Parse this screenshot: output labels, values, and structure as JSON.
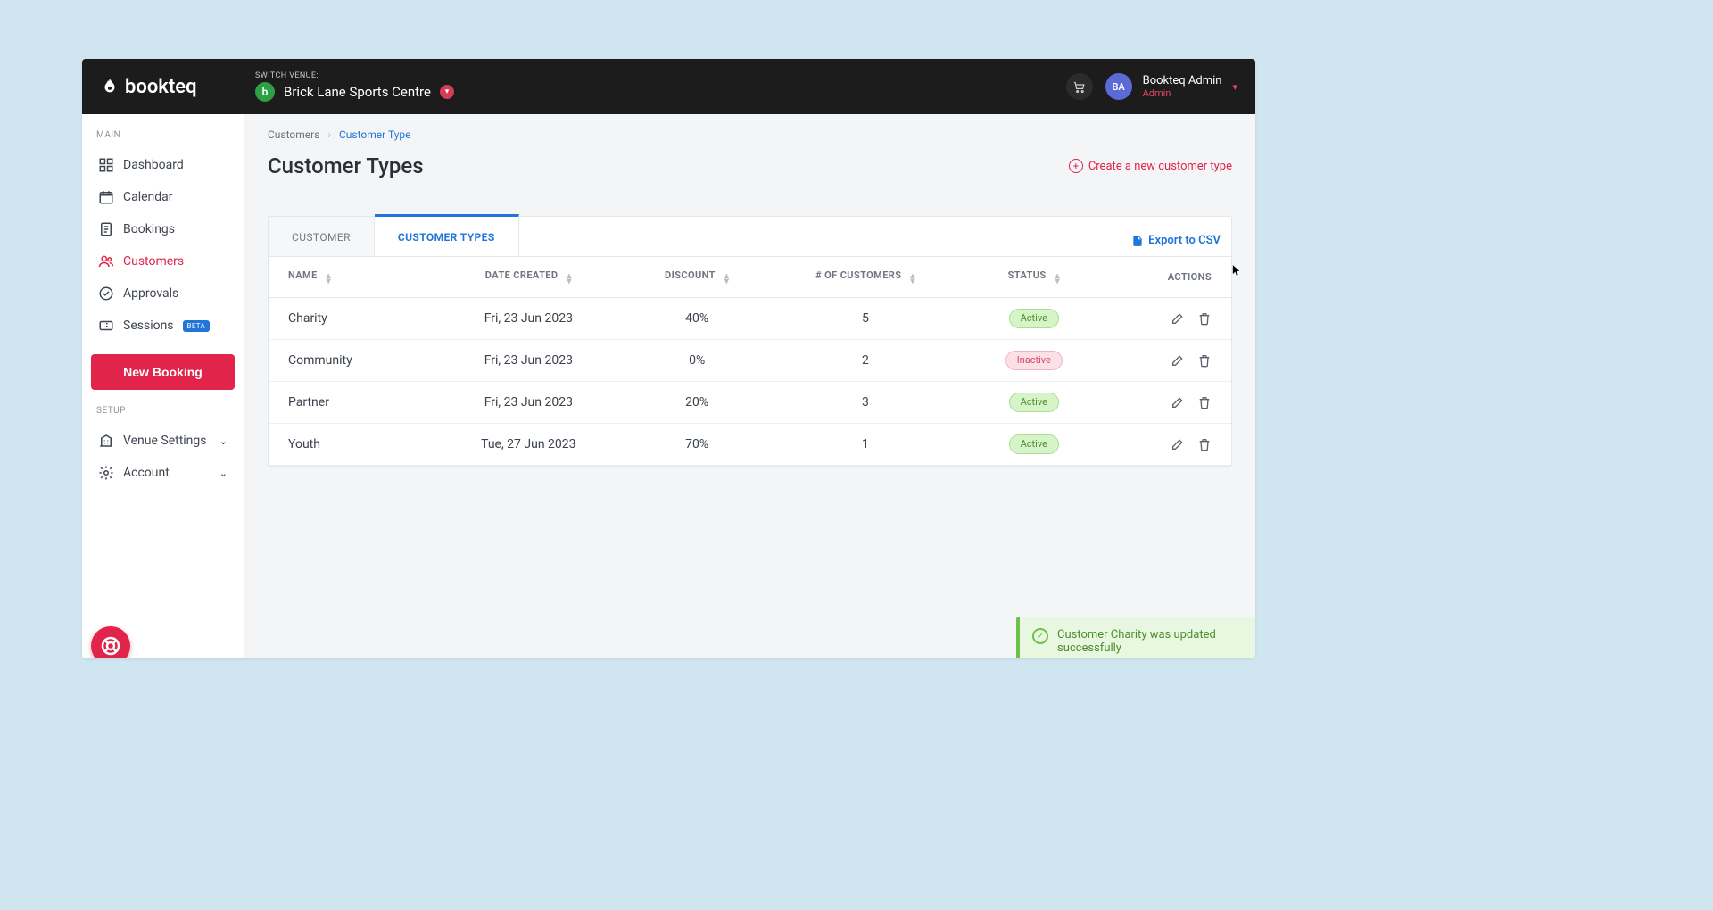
{
  "brand": "bookteq",
  "header": {
    "switch_label": "SWITCH VENUE:",
    "venue_initial": "b",
    "venue_name": "Brick Lane Sports Centre",
    "avatar_initials": "BA",
    "user_name": "Bookteq Admin",
    "user_role": "Admin"
  },
  "sidebar": {
    "section_main": "MAIN",
    "section_setup": "SETUP",
    "items": {
      "dashboard": "Dashboard",
      "calendar": "Calendar",
      "bookings": "Bookings",
      "customers": "Customers",
      "approvals": "Approvals",
      "sessions": "Sessions",
      "sessions_badge": "BETA",
      "venue_settings": "Venue Settings",
      "account": "Account"
    },
    "new_booking": "New Booking"
  },
  "breadcrumbs": {
    "root": "Customers",
    "current": "Customer Type"
  },
  "page": {
    "title": "Customer Types",
    "create_label": "Create a new customer type",
    "export_label": "Export to CSV"
  },
  "tabs": {
    "customer": "CUSTOMER",
    "customer_types": "CUSTOMER TYPES"
  },
  "table": {
    "cols": {
      "name": "NAME",
      "date_created": "DATE CREATED",
      "discount": "DISCOUNT",
      "num_customers": "# OF CUSTOMERS",
      "status": "STATUS",
      "actions": "ACTIONS"
    },
    "rows": [
      {
        "name": "Charity",
        "date": "Fri, 23 Jun 2023",
        "discount": "40%",
        "count": "5",
        "status": "Active"
      },
      {
        "name": "Community",
        "date": "Fri, 23 Jun 2023",
        "discount": "0%",
        "count": "2",
        "status": "Inactive"
      },
      {
        "name": "Partner",
        "date": "Fri, 23 Jun 2023",
        "discount": "20%",
        "count": "3",
        "status": "Active"
      },
      {
        "name": "Youth",
        "date": "Tue, 27 Jun 2023",
        "discount": "70%",
        "count": "1",
        "status": "Active"
      }
    ]
  },
  "toast": {
    "message": "Customer Charity was updated successfully"
  },
  "colors": {
    "accent_red": "#e1244a",
    "accent_blue": "#1f76d8"
  }
}
